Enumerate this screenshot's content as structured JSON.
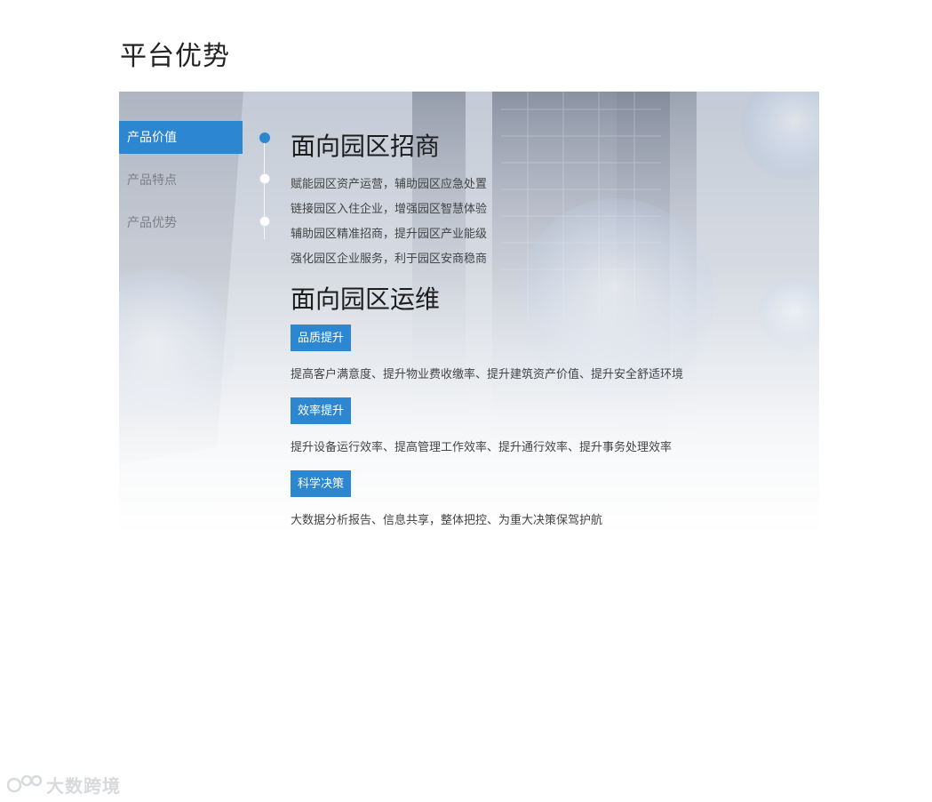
{
  "page": {
    "title": "平台优势"
  },
  "side_nav": {
    "items": [
      {
        "label": "产品价值",
        "active": true
      },
      {
        "label": "产品特点",
        "active": false
      },
      {
        "label": "产品优势",
        "active": false
      }
    ]
  },
  "content": {
    "section1": {
      "title": "面向园区招商",
      "lines": [
        "赋能园区资产运营，辅助园区应急处置",
        "链接园区入住企业，增强园区智慧体验",
        "辅助园区精准招商，提升园区产业能级",
        "强化园区企业服务，利于园区安商稳商"
      ]
    },
    "section2": {
      "title": "面向园区运维",
      "items": [
        {
          "tag": "品质提升",
          "desc": "提高客户满意度、提升物业费收缴率、提升建筑资产价值、提升安全舒适环境"
        },
        {
          "tag": "效率提升",
          "desc": "提升设备运行效率、提高管理工作效率、提升通行效率、提升事务处理效率"
        },
        {
          "tag": "科学决策",
          "desc": "大数据分析报告、信息共享，整体把控、为重大决策保驾护航"
        }
      ]
    }
  },
  "watermark": {
    "text": "大数跨境",
    "icon": "logo-icon"
  },
  "colors": {
    "accent": "#2d86d0",
    "title_text": "#222222",
    "body_text": "#444444",
    "nav_inactive_text": "#7b8088"
  }
}
